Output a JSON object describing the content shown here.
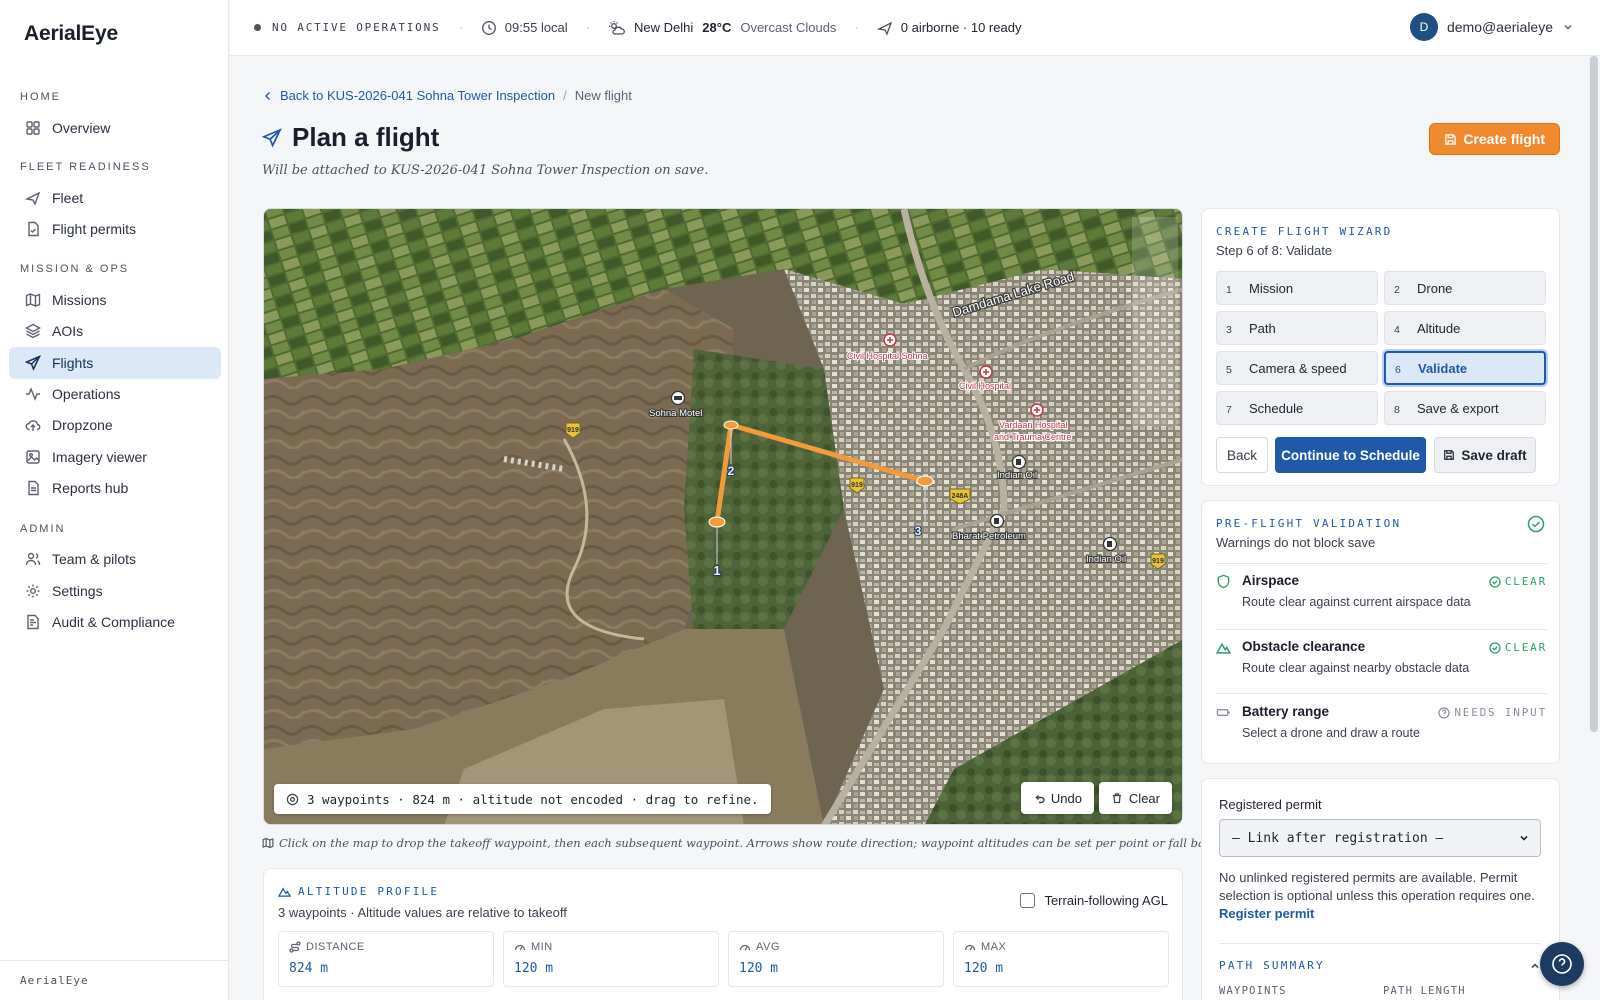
{
  "app": {
    "brand": "AerialEye",
    "footer": "AerialEye"
  },
  "sidebar": {
    "sections": [
      {
        "title": "HOME",
        "items": [
          {
            "label": "Overview",
            "icon": "grid-icon"
          }
        ]
      },
      {
        "title": "FLEET READINESS",
        "items": [
          {
            "label": "Fleet",
            "icon": "plane-icon"
          },
          {
            "label": "Flight permits",
            "icon": "file-check-icon"
          }
        ]
      },
      {
        "title": "MISSION & OPS",
        "items": [
          {
            "label": "Missions",
            "icon": "map-icon"
          },
          {
            "label": "AOIs",
            "icon": "layers-icon"
          },
          {
            "label": "Flights",
            "icon": "send-icon",
            "active": true
          },
          {
            "label": "Operations",
            "icon": "activity-icon"
          },
          {
            "label": "Dropzone",
            "icon": "upload-cloud-icon"
          },
          {
            "label": "Imagery viewer",
            "icon": "image-icon"
          },
          {
            "label": "Reports hub",
            "icon": "report-icon"
          }
        ]
      },
      {
        "title": "ADMIN",
        "items": [
          {
            "label": "Team & pilots",
            "icon": "users-icon"
          },
          {
            "label": "Settings",
            "icon": "gear-icon"
          },
          {
            "label": "Audit & Compliance",
            "icon": "audit-icon"
          }
        ]
      }
    ]
  },
  "topbar": {
    "status": "NO ACTIVE OPERATIONS",
    "time": "09:55 local",
    "city": "New Delhi",
    "temp": "28°C",
    "weather": "Overcast Clouds",
    "fleet": "0 airborne · 10 ready",
    "user_initial": "D",
    "user_email": "demo@aerialeye"
  },
  "page": {
    "back_link": "Back to KUS-2026-041 Sohna Tower Inspection",
    "crumb_current": "New flight",
    "title": "Plan a flight",
    "subtitle": "Will be attached to KUS-2026-041 Sohna Tower Inspection on save.",
    "create_button": "Create flight"
  },
  "map": {
    "info": "3 waypoints · 824 m · altitude not encoded · drag to refine.",
    "undo": "Undo",
    "clear": "Clear",
    "hint": "Click on the map to drop the takeoff waypoint, then each subsequent waypoint. Arrows show route direction; waypoint altitudes can be set per point or fall back to max altitude.",
    "labels": {
      "road": "Damdama Lake Road",
      "civil_sohna": "Civil Hospital Sohna",
      "civil": "Civil Hospital",
      "vardaan1": "Vardaan Hospital",
      "vardaan2": "and Trauma Centre",
      "indian_oil_1": "Indian Oil",
      "indian_oil_2": "Indian Oil",
      "bharat": "Bharat Petroleum",
      "motel": "Sohna Motel",
      "shield_919a": "919",
      "shield_919b": "919",
      "shield_919c": "919",
      "shield_248a": "248A",
      "wp1": "1",
      "wp2": "2",
      "wp3": "3"
    }
  },
  "altitude": {
    "title": "ALTITUDE PROFILE",
    "subtitle": "3 waypoints · Altitude values are relative to takeoff",
    "terrain_label": "Terrain-following AGL",
    "stats": [
      {
        "label": "DISTANCE",
        "value": "824 m",
        "icon": "route-icon"
      },
      {
        "label": "MIN",
        "value": "120 m",
        "icon": "gauge-icon"
      },
      {
        "label": "AVG",
        "value": "120 m",
        "icon": "gauge-icon"
      },
      {
        "label": "MAX",
        "value": "120 m",
        "icon": "gauge-icon"
      }
    ]
  },
  "wizard": {
    "title": "CREATE FLIGHT WIZARD",
    "subtitle": "Step 6 of 8: Validate",
    "steps": [
      {
        "n": "1",
        "label": "Mission"
      },
      {
        "n": "2",
        "label": "Drone"
      },
      {
        "n": "3",
        "label": "Path"
      },
      {
        "n": "4",
        "label": "Altitude"
      },
      {
        "n": "5",
        "label": "Camera & speed"
      },
      {
        "n": "6",
        "label": "Validate",
        "active": true
      },
      {
        "n": "7",
        "label": "Schedule"
      },
      {
        "n": "8",
        "label": "Save & export"
      }
    ],
    "back": "Back",
    "continue": "Continue to Schedule",
    "save_draft": "Save draft"
  },
  "validation": {
    "title": "PRE-FLIGHT VALIDATION",
    "subtitle": "Warnings do not block save",
    "items": [
      {
        "title": "Airspace",
        "desc": "Route clear against current airspace data",
        "status": "CLEAR",
        "color": "#2f9e6a"
      },
      {
        "title": "Obstacle clearance",
        "desc": "Route clear against nearby obstacle data",
        "status": "CLEAR",
        "color": "#2f9e6a"
      },
      {
        "title": "Battery range",
        "desc": "Select a drone and draw a route",
        "status": "NEEDS INPUT",
        "color": "#8a909c"
      }
    ]
  },
  "permit": {
    "label": "Registered permit",
    "select_value": "— Link after registration —",
    "text": "No unlinked registered permits are available. Permit selection is optional unless this operation requires one.",
    "link": "Register permit",
    "path_summary": "PATH SUMMARY",
    "col_waypoints": "WAYPOINTS",
    "col_length": "PATH LENGTH"
  },
  "colors": {
    "accent": "#1e5aa8",
    "brand_orange": "#f08a2c",
    "route": "#f39a3a",
    "ok": "#2f9e6a"
  }
}
